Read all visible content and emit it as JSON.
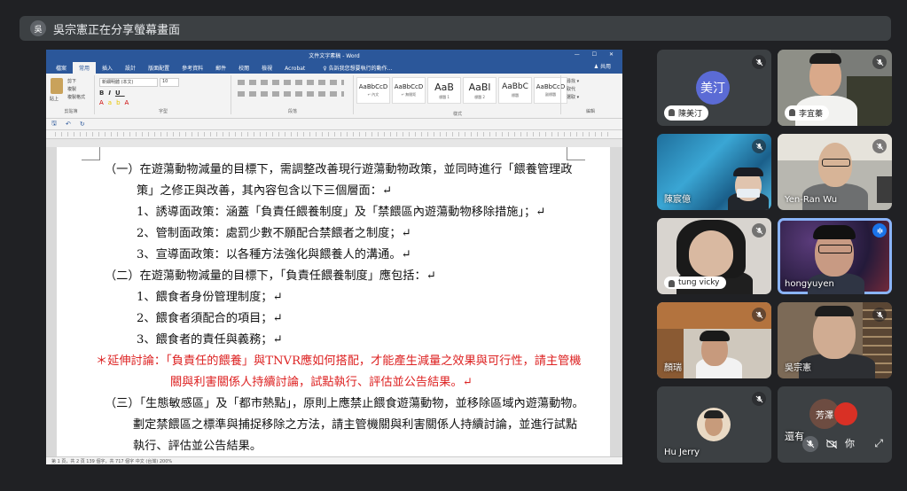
{
  "banner": {
    "avatar": "吳",
    "text": "吳宗憲正在分享螢幕畫面"
  },
  "word": {
    "title": "文件文字素稿 - Word",
    "window_controls": "— ☐ ✕",
    "tabs": [
      "檔案",
      "常用",
      "插入",
      "設計",
      "版面配置",
      "參考資料",
      "郵件",
      "校閱",
      "檢視",
      "Acrobat"
    ],
    "tell_me": "♀ 告訴我您想要執行的動作...",
    "share_button": "♟ 共用",
    "font_name": "新細明體 (本文)",
    "font_size": "10",
    "clipboard": {
      "paste": "貼上",
      "cut": "剪下",
      "copy": "複製",
      "format_painter": "複製格式"
    },
    "group_labels": {
      "clipboard": "剪貼簿",
      "font": "字型",
      "paragraph": "段落",
      "styles": "樣式",
      "editing": "編輯"
    },
    "styles": [
      {
        "preview": "AaBbCcD",
        "name": "↵ 內文"
      },
      {
        "preview": "AaBbCcD",
        "name": "↵ 無間距"
      },
      {
        "preview": "AaB",
        "name": "標題 1"
      },
      {
        "preview": "AaBl",
        "name": "標題 2"
      },
      {
        "preview": "AaBbC",
        "name": "標題"
      },
      {
        "preview": "AaBbCcD",
        "name": "副標題"
      }
    ],
    "editing": [
      "尋找 ▾",
      "取代",
      "選取 ▾"
    ],
    "quick_access": [
      "🖫",
      "↶",
      "↻"
    ],
    "status": "第 1 頁，共 2 頁   139 個字，共 717 個字   中文 (台灣)                                                                                                                                    200%",
    "document_lines": [
      {
        "text": "（一）在遊蕩動物減量的目標下，需調整改善現行遊蕩動物政策，並同時進行「餵養管理政",
        "red": false
      },
      {
        "text": "策」之修正與改善，其內容包含以下三個層面：↵",
        "red": false
      },
      {
        "text": "1、誘導面政策：涵蓋「負責任餵養制度」及「禁餵區內遊蕩動物移除措施」；↵",
        "red": false
      },
      {
        "text": "2、管制面政策：處罰少數不願配合禁餵者之制度；↵",
        "red": false
      },
      {
        "text": "3、宣導面政策：以各種方法強化與餵養人的溝通。↵",
        "red": false
      },
      {
        "text": "（二）在遊蕩動物減量的目標下，「負責任餵養制度」應包括：↵",
        "red": false
      },
      {
        "text": "1、餵食者身份管理制度；↵",
        "red": false
      },
      {
        "text": "2、餵食者須配合的項目；↵",
        "red": false
      },
      {
        "text": "3、餵食者的責任與義務；↵",
        "red": false
      },
      {
        "text": "＊延伸討論：「負責任的餵養」與TNVR應如何搭配，才能產生減量之效果與可行性，請主管機",
        "red": true
      },
      {
        "text": "關與利害關係人持續討論，試點執行、評估並公告結果。↵",
        "red": true
      },
      {
        "text": "（三）「生態敏感區」及「都市熱點」，原則上應禁止餵食遊蕩動物，並移除區域內遊蕩動物。",
        "red": false
      },
      {
        "text": "劃定禁餵區之標準與捕捉移除之方法，請主管機關與利害關係人持續討論，並進行試點",
        "red": false
      },
      {
        "text": "執行、評估並公告結果。",
        "red": false
      }
    ]
  },
  "participants": [
    {
      "name": "陳美汀",
      "avatar_text": "美汀",
      "avatar_color": "#5b6bd5",
      "muted": true
    },
    {
      "name": "李宜蓁",
      "muted": true
    },
    {
      "name": "陳宸億",
      "muted": true
    },
    {
      "name": "Yen-Ran Wu",
      "muted": true
    },
    {
      "name": "tung vicky",
      "muted": true
    },
    {
      "name": "hongyuyen",
      "speaking": true
    },
    {
      "name": "顏瑞",
      "muted": true
    },
    {
      "name": "吳宗憲",
      "muted": true
    },
    {
      "name": "Hu Jerry",
      "muted": true
    },
    {
      "name": "還有",
      "avatar_text": "芳澤",
      "you_label": "你",
      "muted": true
    }
  ],
  "colors": {
    "word_blue": "#2b579a",
    "meet_bg": "#202124",
    "tile_bg": "#3c4043",
    "speaking": "#8ab4f8"
  }
}
